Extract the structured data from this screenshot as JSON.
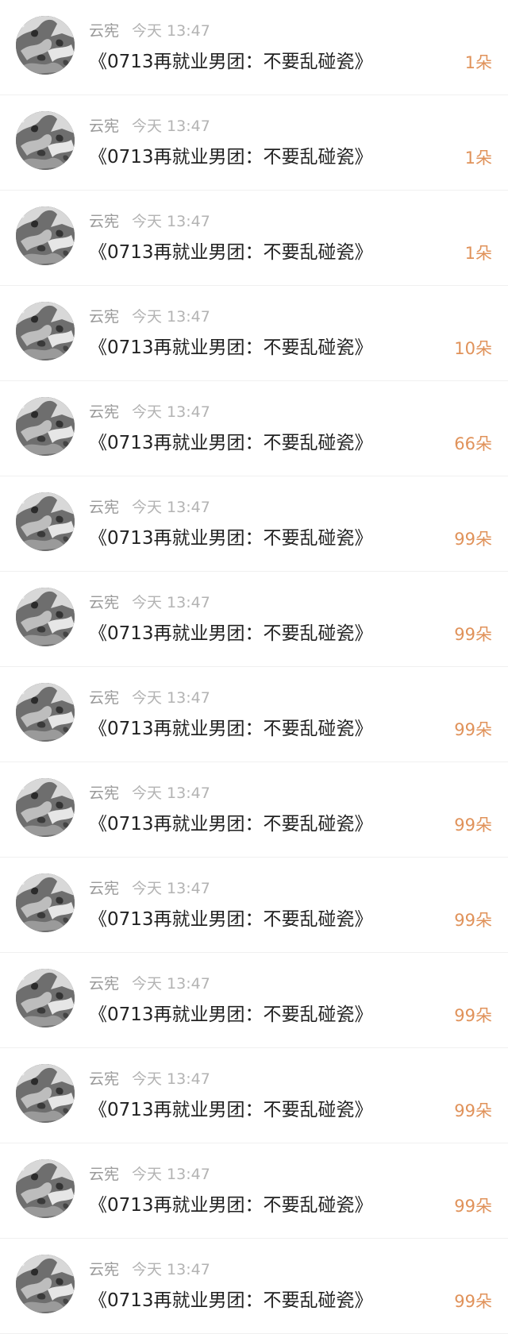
{
  "items": [
    {
      "user": "云宪",
      "time": "今天 13:47",
      "title": "《0713再就业男团：不要乱碰瓷》",
      "count": "1朵"
    },
    {
      "user": "云宪",
      "time": "今天 13:47",
      "title": "《0713再就业男团：不要乱碰瓷》",
      "count": "1朵"
    },
    {
      "user": "云宪",
      "time": "今天 13:47",
      "title": "《0713再就业男团：不要乱碰瓷》",
      "count": "1朵"
    },
    {
      "user": "云宪",
      "time": "今天 13:47",
      "title": "《0713再就业男团：不要乱碰瓷》",
      "count": "10朵"
    },
    {
      "user": "云宪",
      "time": "今天 13:47",
      "title": "《0713再就业男团：不要乱碰瓷》",
      "count": "66朵"
    },
    {
      "user": "云宪",
      "time": "今天 13:47",
      "title": "《0713再就业男团：不要乱碰瓷》",
      "count": "99朵"
    },
    {
      "user": "云宪",
      "time": "今天 13:47",
      "title": "《0713再就业男团：不要乱碰瓷》",
      "count": "99朵"
    },
    {
      "user": "云宪",
      "time": "今天 13:47",
      "title": "《0713再就业男团：不要乱碰瓷》",
      "count": "99朵"
    },
    {
      "user": "云宪",
      "time": "今天 13:47",
      "title": "《0713再就业男团：不要乱碰瓷》",
      "count": "99朵"
    },
    {
      "user": "云宪",
      "time": "今天 13:47",
      "title": "《0713再就业男团：不要乱碰瓷》",
      "count": "99朵"
    },
    {
      "user": "云宪",
      "time": "今天 13:47",
      "title": "《0713再就业男团：不要乱碰瓷》",
      "count": "99朵"
    },
    {
      "user": "云宪",
      "time": "今天 13:47",
      "title": "《0713再就业男团：不要乱碰瓷》",
      "count": "99朵"
    },
    {
      "user": "云宪",
      "time": "今天 13:47",
      "title": "《0713再就业男团：不要乱碰瓷》",
      "count": "99朵"
    },
    {
      "user": "云宪",
      "time": "今天 13:47",
      "title": "《0713再就业男团：不要乱碰瓷》",
      "count": "99朵"
    }
  ],
  "colors": {
    "count_accent": "#e0925a",
    "title_text": "#222222",
    "name_text": "#9a9a9a",
    "time_text": "#b3b3b3"
  },
  "icons": {
    "avatar": "user-avatar-image"
  }
}
